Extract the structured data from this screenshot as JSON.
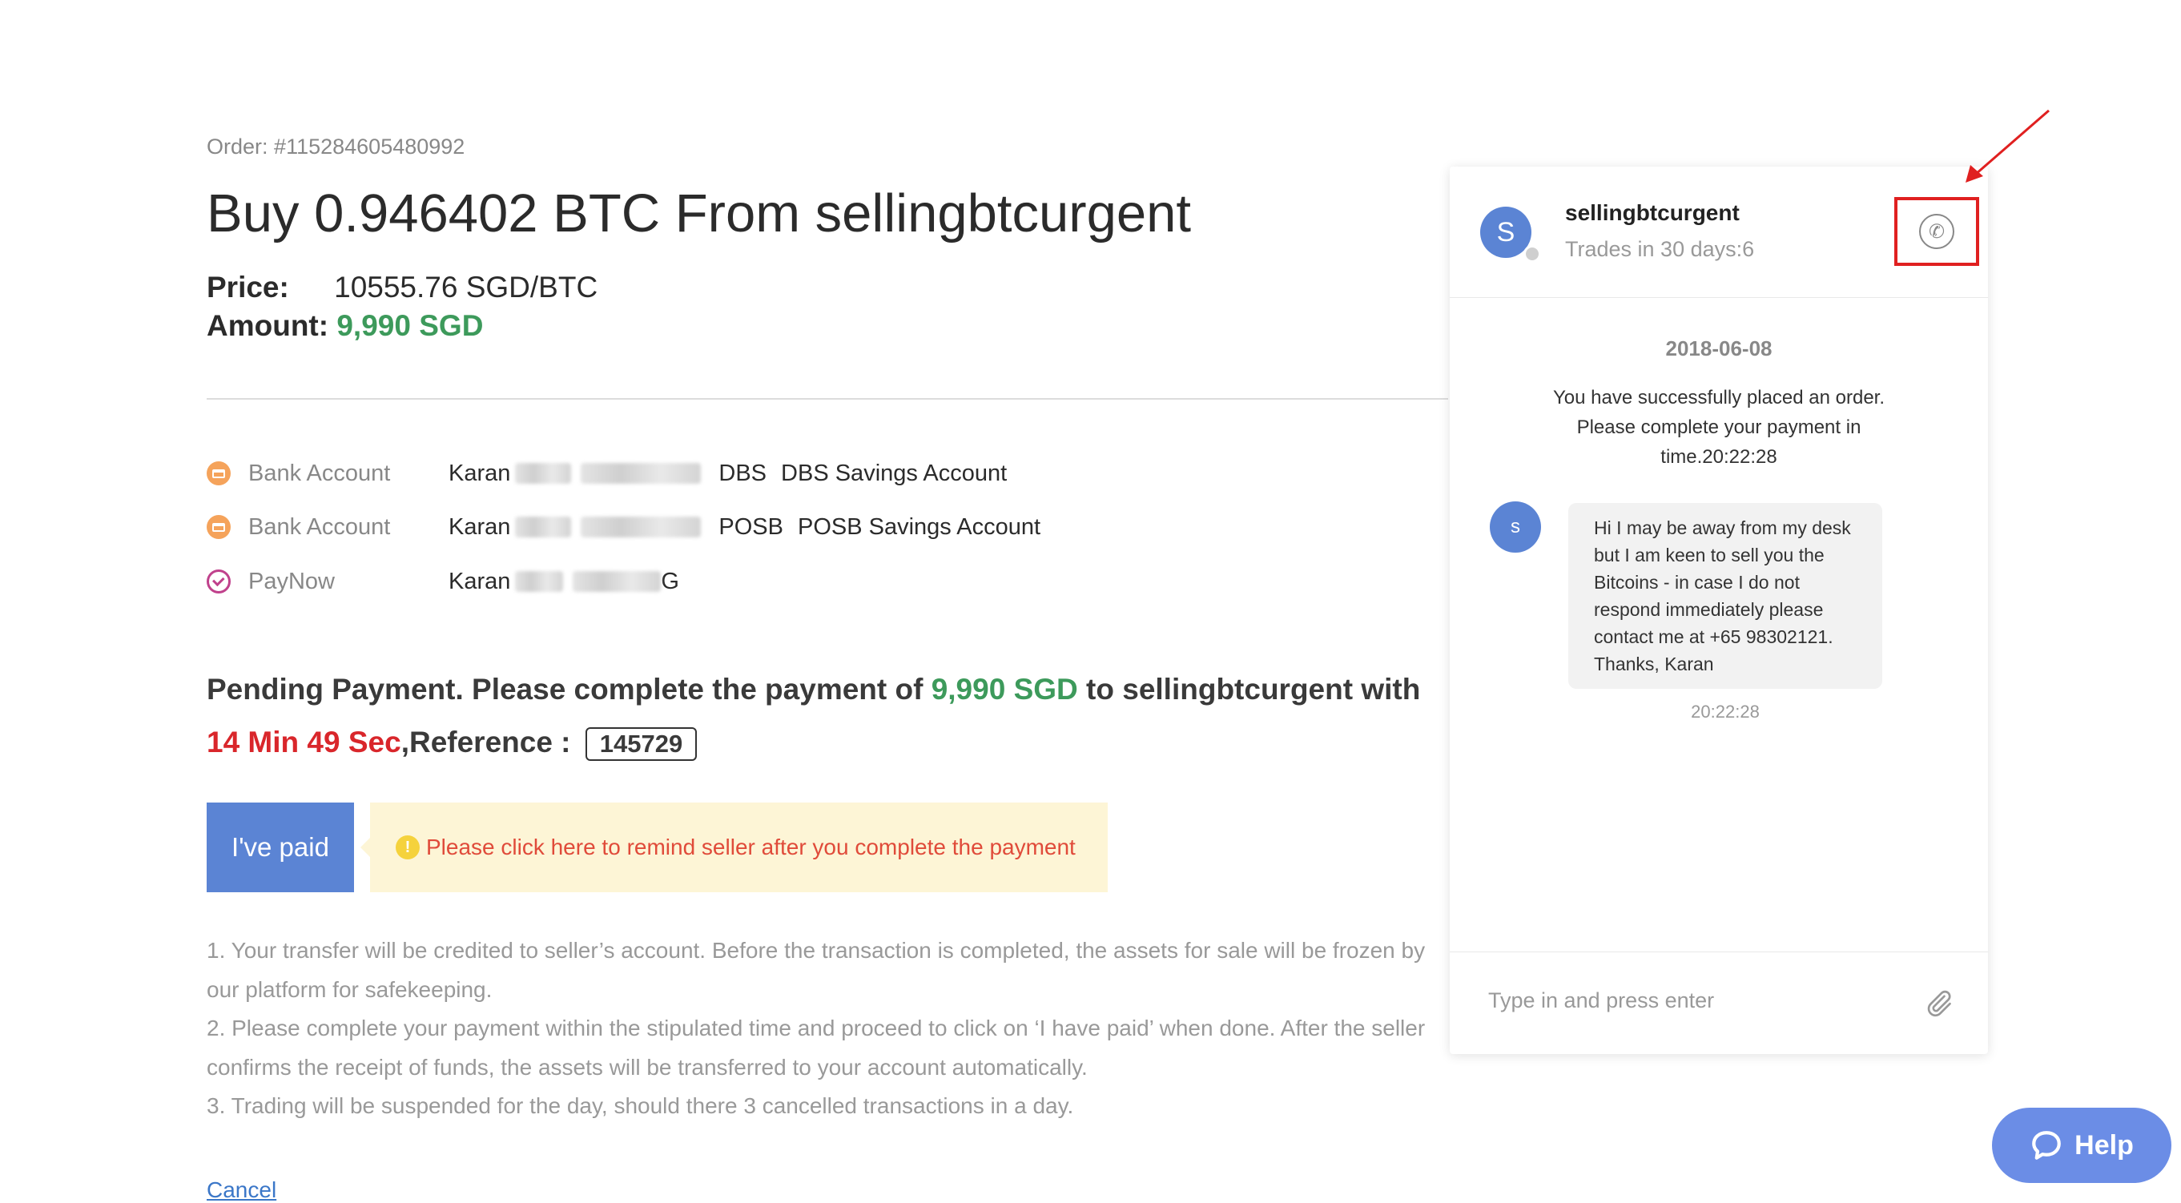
{
  "order": {
    "label": "Order:",
    "id": "#115284605480992",
    "title": "Buy 0.946402 BTC From sellingbtcurgent",
    "price_label": "Price:",
    "price_value": "10555.76 SGD/BTC",
    "amount_label": "Amount:",
    "amount_value": "9,990 SGD"
  },
  "payment_methods": [
    {
      "icon": "bank-card-icon",
      "type": "Bank Account",
      "holder": "Karan",
      "bank": "DBS",
      "account": "DBS Savings Account"
    },
    {
      "icon": "bank-card-icon",
      "type": "Bank Account",
      "holder": "Karan",
      "bank": "POSB",
      "account": "POSB Savings Account"
    },
    {
      "icon": "paynow-check-icon",
      "type": "PayNow",
      "holder": "Karan",
      "suffix": "G"
    }
  ],
  "pending": {
    "prefix": "Pending Payment. Please complete the payment of",
    "amount": "9,990 SGD",
    "middle": "to sellingbtcurgent with",
    "time": "14 Min 49 Sec",
    "ref_label": ",Reference :",
    "reference": "145729"
  },
  "actions": {
    "paid_label": "I've paid",
    "notice": "Please click here to remind seller after you complete the payment",
    "cancel_label": "Cancel"
  },
  "rules": [
    "1. Your transfer will be credited to seller’s account. Before the transaction is completed, the assets for sale will be frozen by our platform for safekeeping.",
    "2. Please complete your payment within the stipulated time and proceed to click on ‘I have paid’ when done. After the seller confirms the receipt of funds, the assets will be transferred to your account automatically.",
    "3. Trading will be suspended for the day, should there 3 cancelled transactions in a day."
  ],
  "chat": {
    "seller_initial": "S",
    "seller_name": "sellingbtcurgent",
    "trades": "Trades in 30 days:6",
    "date": "2018-06-08",
    "system_message": "You have successfully placed an order. Please complete your payment in time.20:22:28",
    "message_initial": "s",
    "message": "Hi I may be away from my desk but I am keen to sell you the Bitcoins - in case I do not respond immediately please contact me at +65 98302121. Thanks, Karan",
    "message_time": "20:22:28",
    "input_placeholder": "Type in and press enter"
  },
  "help": {
    "label": "Help"
  },
  "colors": {
    "accent_green": "#3d9a5b",
    "alert_red": "#d9262b",
    "button_blue": "#5b84d4",
    "highlight_box": "#e02020"
  }
}
